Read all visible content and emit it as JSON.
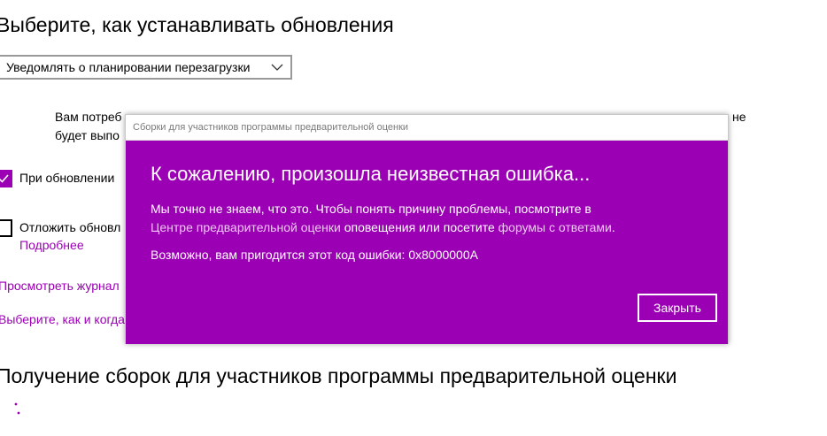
{
  "settings": {
    "updates_heading": "Выберите, как устанавливать обновления",
    "mode_select": {
      "selected": "Уведомлять о планировании перезагрузки",
      "icon": "chevron-down-icon"
    },
    "restart_note": {
      "line1": "Вам потреб",
      "line2": "будет выпо",
      "tail": "не"
    },
    "checkbox_other_products": {
      "label": "При обновлении",
      "checked": true
    },
    "checkbox_defer": {
      "label": "Отложить обновл",
      "checked": false
    },
    "details_link": "Подробнее",
    "history_link": "Просмотреть журнал",
    "delivery_link": "Выберите, как и когда",
    "insider_heading": "Получение сборок для участников программы предварительной оценки",
    "loading_icon": "loading-dots-icon"
  },
  "dialog": {
    "title": "Сборки для участников программы предварительной оценки",
    "heading": "К сожалению, произошла неизвестная ошибка...",
    "message_line1": "Мы точно не знаем, что это. Чтобы понять причину проблемы, посмотрите в",
    "hub_link": "Центре предварительной оценки",
    "message_mid": " оповещения или посетите ",
    "forums_link": "форумы с ответами",
    "message_end": ".",
    "error_code_line": "Возможно, вам пригодится этот код ошибки: 0x8000000A",
    "close_label": "Закрыть"
  },
  "colors": {
    "accent": "#9b00b4",
    "dialog_background": "#9b00b4",
    "dialog_text": "#ffffff",
    "title_text": "#7a7a7a"
  }
}
